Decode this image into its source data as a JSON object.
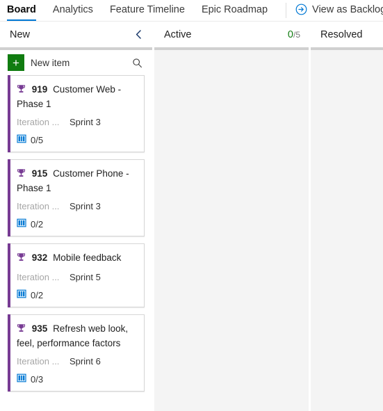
{
  "tabs": [
    {
      "label": "Board",
      "active": true
    },
    {
      "label": "Analytics",
      "active": false
    },
    {
      "label": "Feature Timeline",
      "active": false
    },
    {
      "label": "Epic Roadmap",
      "active": false
    }
  ],
  "view_backlog": {
    "label": "View as Backlog",
    "icon": "circle-arrow-right-icon",
    "color": "#0078d4"
  },
  "toolbar": {
    "new_item_label": "New item",
    "new_item_icon": "plus-icon",
    "new_item_color": "#107c10",
    "search_icon": "search-icon"
  },
  "columns": [
    {
      "name": "New",
      "limit_current": "",
      "limit_max": "",
      "collapsible": true,
      "collapse_icon": "chevron-left-icon"
    },
    {
      "name": "Active",
      "limit_current": "0",
      "limit_max": "/5",
      "collapsible": false,
      "collapse_icon": ""
    },
    {
      "name": "Resolved",
      "limit_current": "",
      "limit_max": "",
      "collapsible": false,
      "collapse_icon": ""
    }
  ],
  "accent_colors": {
    "tab_underline": "#0078d4",
    "card_stripe": "#773b93",
    "work_item_type": "#773b93",
    "child_count": "#0078d4",
    "limit_ok": "#107c10"
  },
  "cards": [
    {
      "icon": "trophy-icon",
      "id": "919",
      "title": "Customer Web - Phase 1",
      "field_label": "Iteration ...",
      "field_value": "Sprint 3",
      "child_icon": "book-icon",
      "child_count": "0/5"
    },
    {
      "icon": "trophy-icon",
      "id": "915",
      "title": "Customer Phone - Phase 1",
      "field_label": "Iteration ...",
      "field_value": "Sprint 3",
      "child_icon": "book-icon",
      "child_count": "0/2"
    },
    {
      "icon": "trophy-icon",
      "id": "932",
      "title": "Mobile feedback",
      "field_label": "Iteration ...",
      "field_value": "Sprint 5",
      "child_icon": "book-icon",
      "child_count": "0/2"
    },
    {
      "icon": "trophy-icon",
      "id": "935",
      "title": "Refresh web look, feel, performance factors",
      "field_label": "Iteration ...",
      "field_value": "Sprint 6",
      "child_icon": "book-icon",
      "child_count": "0/3"
    }
  ]
}
